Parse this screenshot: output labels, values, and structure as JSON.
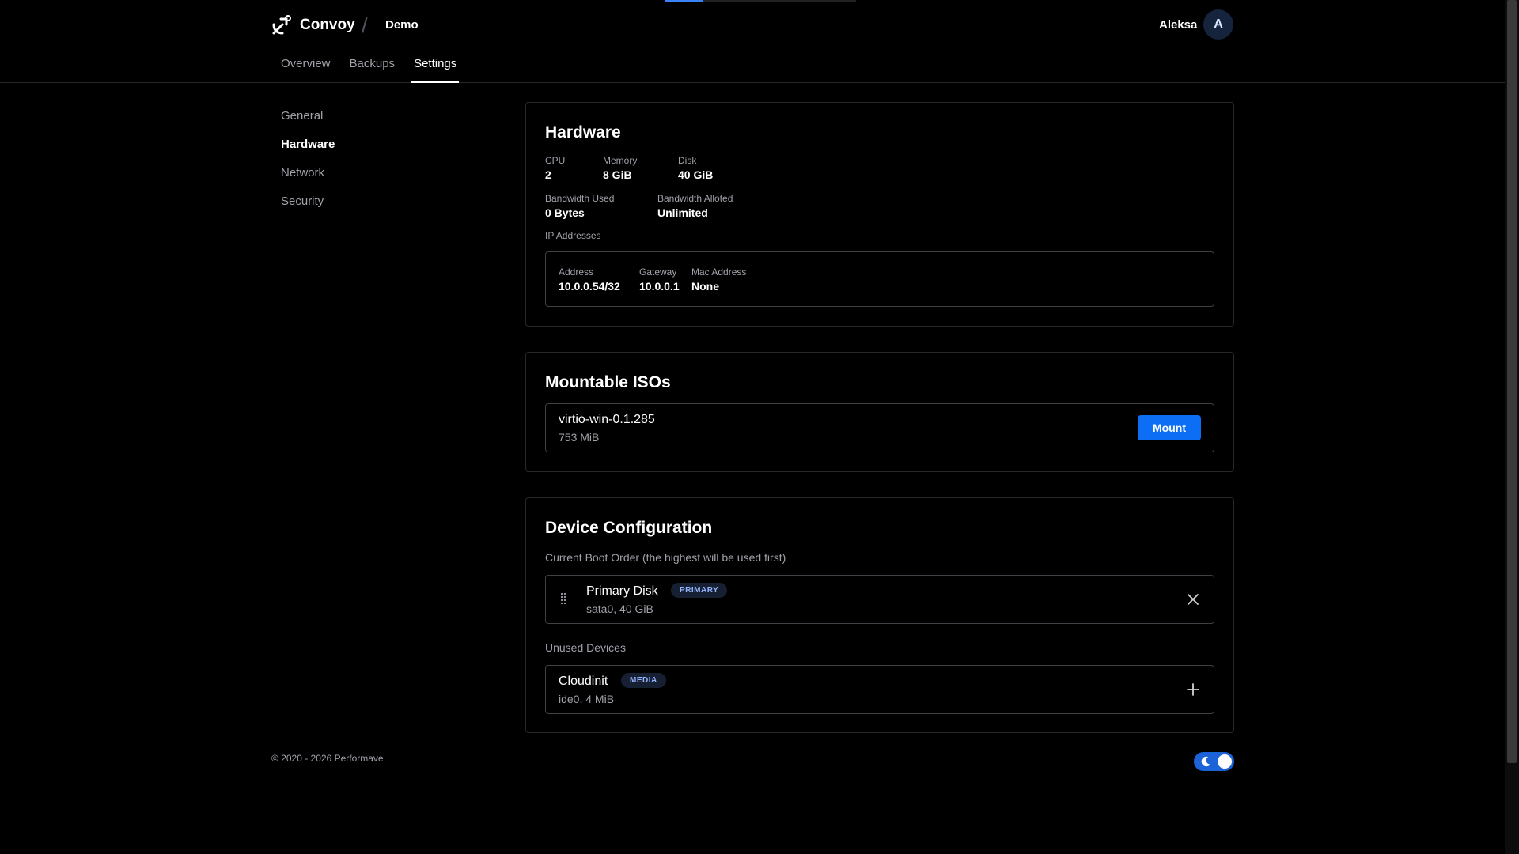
{
  "header": {
    "brand": "Convoy",
    "crumb_separator": "/",
    "breadcrumb": "Demo",
    "user_name": "Aleksa",
    "avatar_initial": "A"
  },
  "tabs": [
    {
      "label": "Overview",
      "active": false
    },
    {
      "label": "Backups",
      "active": false
    },
    {
      "label": "Settings",
      "active": true
    }
  ],
  "sidebar": {
    "items": [
      {
        "label": "General",
        "active": false
      },
      {
        "label": "Hardware",
        "active": true
      },
      {
        "label": "Network",
        "active": false
      },
      {
        "label": "Security",
        "active": false
      }
    ]
  },
  "hardware": {
    "title": "Hardware",
    "cpu": {
      "label": "CPU",
      "value": "2"
    },
    "memory": {
      "label": "Memory",
      "value": "8 GiB"
    },
    "disk": {
      "label": "Disk",
      "value": "40 GiB"
    },
    "bandwidth_used": {
      "label": "Bandwidth Used",
      "value": "0 Bytes"
    },
    "bandwidth_alloted": {
      "label": "Bandwidth Alloted",
      "value": "Unlimited"
    },
    "ip_label": "IP Addresses",
    "ip": {
      "address": {
        "label": "Address",
        "value": "10.0.0.54/32"
      },
      "gateway": {
        "label": "Gateway",
        "value": "10.0.0.1"
      },
      "mac": {
        "label": "Mac Address",
        "value": "None"
      }
    }
  },
  "isos": {
    "title": "Mountable ISOs",
    "item": {
      "name": "virtio-win-0.1.285",
      "size": "753 MiB",
      "button": "Mount"
    }
  },
  "devices": {
    "title": "Device Configuration",
    "boot_order_label": "Current Boot Order (the highest will be used first)",
    "boot_item": {
      "name": "Primary Disk",
      "badge": "PRIMARY",
      "detail": "sata0, 40 GiB"
    },
    "unused_label": "Unused Devices",
    "unused_item": {
      "name": "Cloudinit",
      "badge": "MEDIA",
      "detail": "ide0, 4 MiB"
    }
  },
  "footer": {
    "copyright": "© 2020 - 2026 Performave",
    "theme_toggle_on": true
  },
  "colors": {
    "accent": "#0b6ef5",
    "background": "#000000",
    "border": "#27272a"
  }
}
